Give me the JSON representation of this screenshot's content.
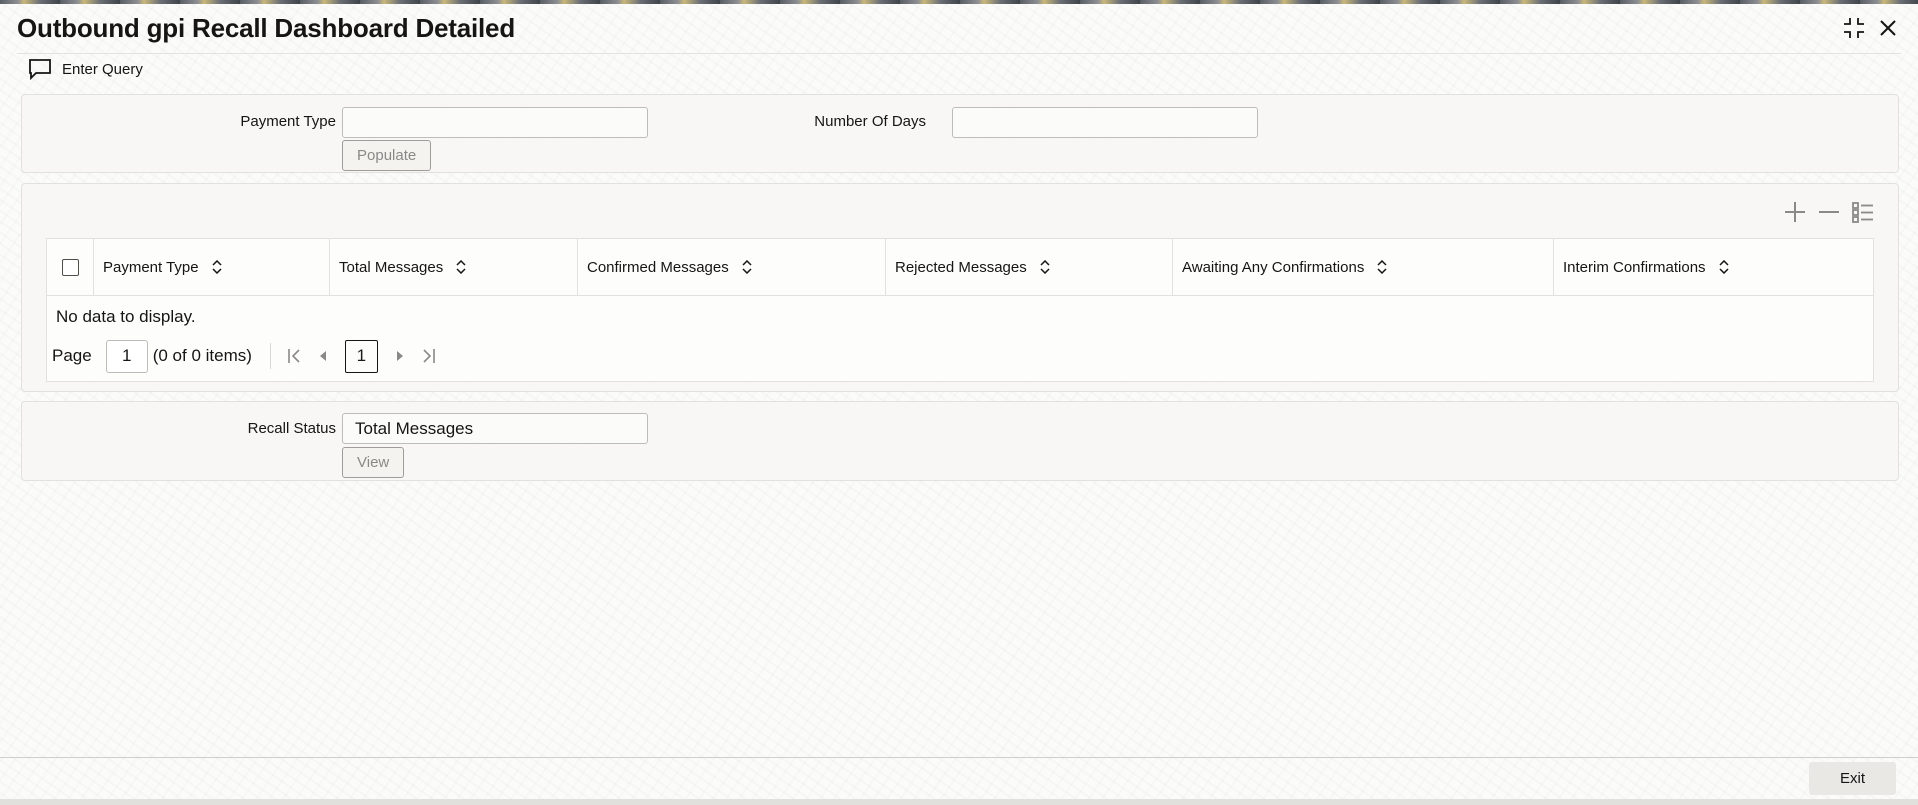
{
  "window": {
    "title": "Outbound gpi Recall Dashboard Detailed"
  },
  "toolbar": {
    "enter_query_label": "Enter Query"
  },
  "query": {
    "payment_type_label": "Payment Type",
    "payment_type_value": "",
    "number_of_days_label": "Number Of Days",
    "number_of_days_value": "",
    "populate_label": "Populate"
  },
  "grid": {
    "columns": [
      "Payment Type",
      "Total Messages",
      "Confirmed Messages",
      "Rejected Messages",
      "Awaiting Any Confirmations",
      "Interim Confirmations"
    ],
    "rows": [],
    "empty_message": "No data to display.",
    "pagination": {
      "page_label": "Page",
      "page_value": "1",
      "items_summary": "(0 of 0 items)",
      "current_page": "1"
    }
  },
  "status": {
    "recall_status_label": "Recall Status",
    "recall_status_value": "Total Messages",
    "view_label": "View"
  },
  "footer": {
    "exit_label": "Exit"
  },
  "icons": {
    "maximize": "maximize-icon",
    "close": "close-icon",
    "enter_query": "chat-bubble-icon",
    "add_row": "plus-icon",
    "delete_row": "minus-icon",
    "single_record": "list-detail-icon",
    "sort": "sort-updown-icon"
  }
}
